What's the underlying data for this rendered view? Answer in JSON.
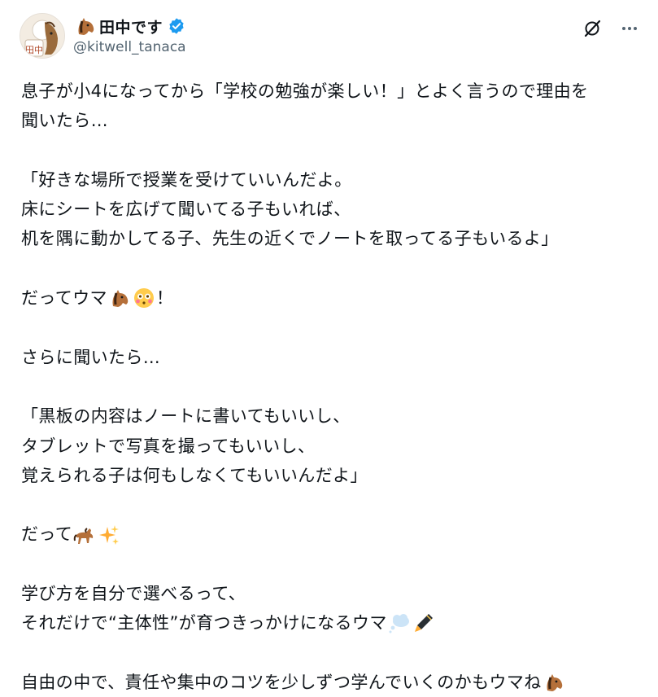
{
  "author": {
    "display_name": "田中です",
    "handle": "@kitwell_tanaca",
    "verified": true,
    "avatar_text": "田中"
  },
  "icons": {
    "verified": "verified-badge-icon",
    "grok": "grok-icon",
    "more": "more-icon",
    "horse_face": "horse-face-emoji",
    "flushed": "flushed-face-emoji",
    "horse": "horse-emoji",
    "sparkles": "sparkles-emoji",
    "thought": "thought-balloon-emoji",
    "pen": "fountain-pen-emoji"
  },
  "colors": {
    "verified": "#1d9bf0",
    "text": "#0f1419",
    "muted": "#536471"
  },
  "tweet": {
    "l1": "息子が小4になってから「学校の勉強が楽しい！」とよく言うので理由を",
    "l2": "聞いたら…",
    "l3": "「好きな場所で授業を受けていいんだよ。",
    "l4": "床にシートを広げて聞いてる子もいれば、",
    "l5": "机を隅に動かしてる子、先生の近くでノートを取ってる子もいるよ」",
    "l6a": "だってウマ",
    "l6b": "！",
    "l7": "さらに聞いたら…",
    "l8": "「黒板の内容はノートに書いてもいいし、",
    "l9": "タブレットで写真を撮ってもいいし、",
    "l10": "覚えられる子は何もしなくてもいいんだよ」",
    "l11": "だって",
    "l12": "学び方を自分で選べるって、",
    "l13": "それだけで“主体性”が育つきっかけになるウマ",
    "l14": "自由の中で、責任や集中のコツを少しずつ学んでいくのかもウマね"
  }
}
